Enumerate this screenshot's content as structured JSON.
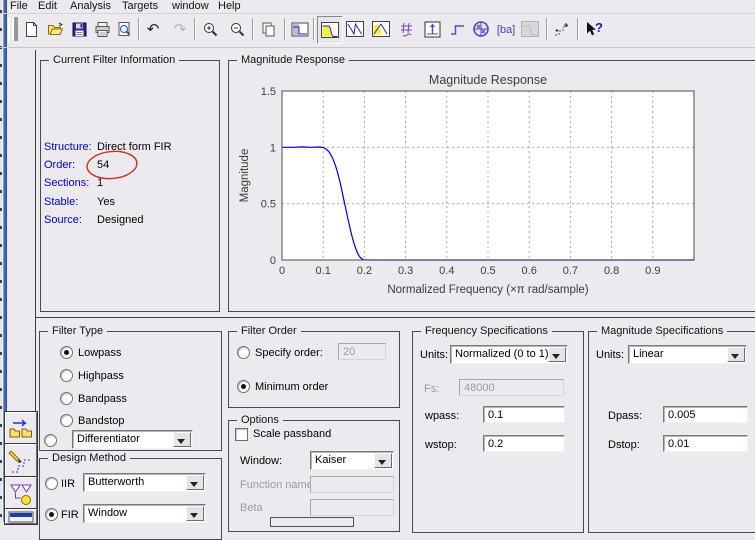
{
  "menu": {
    "items": [
      "File",
      "Edit",
      "Analysis",
      "Targets",
      "window",
      "Help"
    ]
  },
  "toolbar": {
    "icons": [
      "new-document",
      "open-file",
      "save",
      "print",
      "print-preview",
      "undo",
      "redo-disabled",
      "zoom-in",
      "zoom-out",
      "copy",
      "filter-specifications",
      "magnitude-response-selected",
      "phase-response",
      "magnitude-and-phase",
      "group-delay",
      "impulse-response",
      "step-response",
      "pole-zero-plot",
      "filter-coefficients",
      "disabled-analysis",
      "full-view-analysis",
      "context-help"
    ]
  },
  "current_filter_info": {
    "title": "Current Filter Information",
    "rows": [
      {
        "label": "Structure:",
        "value": "Direct form FIR"
      },
      {
        "label": "Order:",
        "value": "54"
      },
      {
        "label": "Sections:",
        "value": "1"
      },
      {
        "label": "Stable:",
        "value": "Yes"
      },
      {
        "label": "Source:",
        "value": "Designed"
      }
    ],
    "annotation": {
      "shape": "hand-drawn ellipse around Order value",
      "color": "#d92a1c"
    }
  },
  "magnitude_panel": {
    "title": "Magnitude Response"
  },
  "chart_data": {
    "type": "line",
    "title": "Magnitude Response",
    "xlabel": "Normalized Frequency  (×π rad/sample)",
    "ylabel": "Magnitude",
    "xlim": [
      0,
      1.0
    ],
    "ylim": [
      0,
      1.5
    ],
    "xticks": [
      0,
      0.1,
      0.2,
      0.3,
      0.4,
      0.5,
      0.6,
      0.7,
      0.8,
      0.9
    ],
    "yticks": [
      0,
      0.5,
      1,
      1.5
    ],
    "grid": true,
    "legend": "none",
    "line_color": "#0000cc",
    "series": [
      {
        "name": "magnitude",
        "points": [
          [
            0,
            1
          ],
          [
            0.03,
            1
          ],
          [
            0.05,
            1.004
          ],
          [
            0.07,
            1
          ],
          [
            0.09,
            1.003
          ],
          [
            0.1,
            0.998
          ],
          [
            0.105,
            0.99
          ],
          [
            0.11,
            0.975
          ],
          [
            0.115,
            0.955
          ],
          [
            0.12,
            0.925
          ],
          [
            0.125,
            0.885
          ],
          [
            0.13,
            0.835
          ],
          [
            0.135,
            0.775
          ],
          [
            0.14,
            0.705
          ],
          [
            0.145,
            0.625
          ],
          [
            0.15,
            0.535
          ],
          [
            0.155,
            0.45
          ],
          [
            0.16,
            0.365
          ],
          [
            0.165,
            0.285
          ],
          [
            0.17,
            0.21
          ],
          [
            0.175,
            0.145
          ],
          [
            0.18,
            0.09
          ],
          [
            0.185,
            0.05
          ],
          [
            0.19,
            0.022
          ],
          [
            0.195,
            0.007
          ],
          [
            0.2,
            0.001
          ],
          [
            0.22,
            0
          ],
          [
            1.0,
            0
          ]
        ]
      }
    ]
  },
  "filter_type": {
    "title": "Filter Type",
    "options": [
      {
        "label": "Lowpass",
        "selected": true
      },
      {
        "label": "Highpass",
        "selected": false
      },
      {
        "label": "Bandpass",
        "selected": false
      },
      {
        "label": "Bandstop",
        "selected": false
      }
    ],
    "dropdown_option": {
      "selected": false,
      "value": "Differentiator"
    }
  },
  "design_method": {
    "title": "Design Method",
    "iir": {
      "label": "IIR",
      "selected": false,
      "value": "Butterworth"
    },
    "fir": {
      "label": "FIR",
      "selected": true,
      "value": "Window"
    }
  },
  "filter_order": {
    "title": "Filter Order",
    "specify": {
      "label": "Specify order:",
      "selected": false,
      "value": "20",
      "disabled": true
    },
    "minimum": {
      "label": "Minimum order",
      "selected": true
    }
  },
  "options_panel": {
    "title": "Options",
    "scale_passband": {
      "label": "Scale passband",
      "checked": false
    },
    "window": {
      "label": "Window:",
      "value": "Kaiser"
    },
    "function_name": {
      "label": "Function name:",
      "value": "",
      "disabled": true
    },
    "beta": {
      "label": "Beta",
      "value": "",
      "disabled": true
    }
  },
  "frequency_specs": {
    "title": "Frequency Specifications",
    "units": {
      "label": "Units:",
      "value": "Normalized (0 to 1)"
    },
    "fs": {
      "label": "Fs:",
      "value": "48000",
      "disabled": true
    },
    "wpass": {
      "label": "wpass:",
      "value": "0.1"
    },
    "wstop": {
      "label": "wstop:",
      "value": "0.2"
    }
  },
  "magnitude_specs": {
    "title": "Magnitude Specifications",
    "units": {
      "label": "Units:",
      "value": "Linear"
    },
    "dpass": {
      "label": "Dpass:",
      "value": "0.005"
    },
    "dstop": {
      "label": "Dstop:",
      "value": "0.01"
    }
  },
  "sidebar": {
    "buttons": [
      "import-export-filter",
      "pole-zero-editor",
      "filter-transformations",
      "partial-window-button"
    ]
  }
}
